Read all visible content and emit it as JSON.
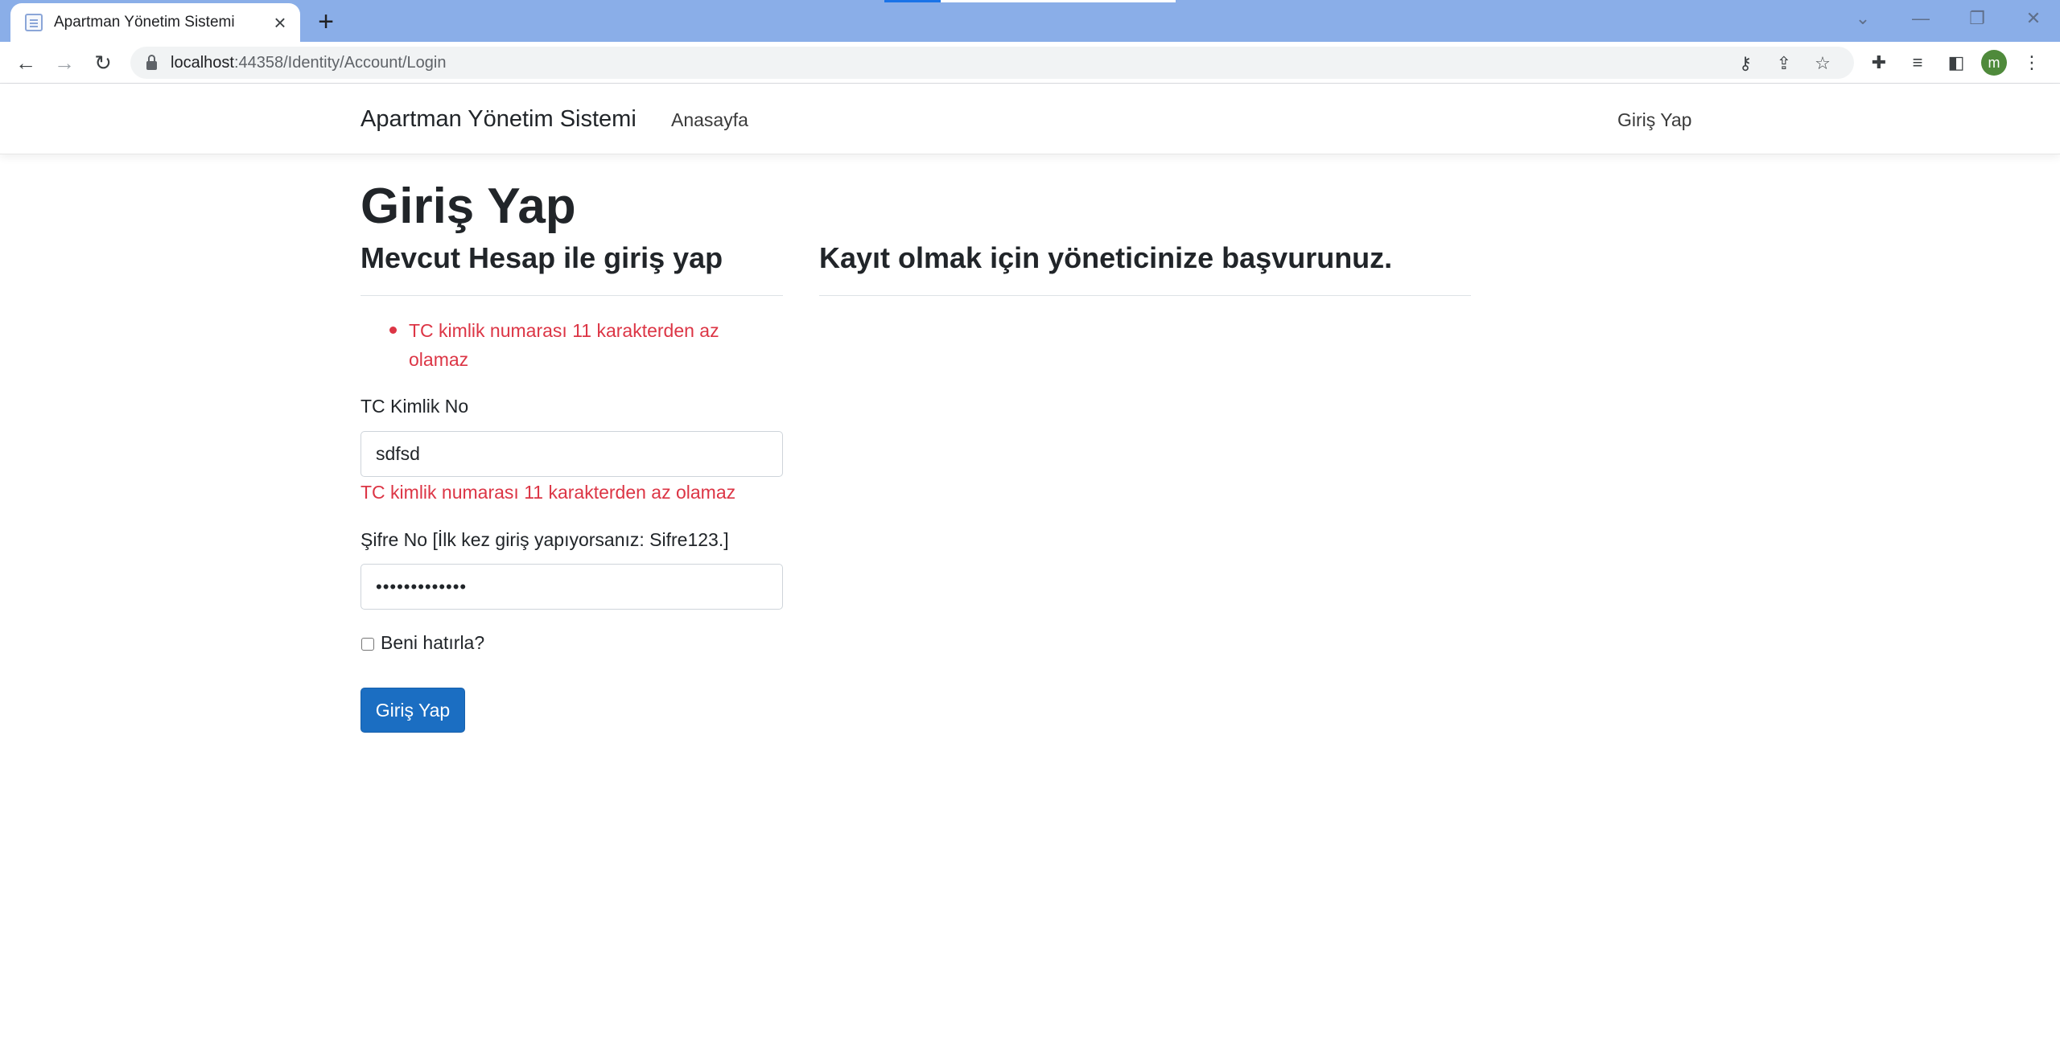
{
  "browser": {
    "tab_title": "Apartman Yönetim Sistemi",
    "url_host": "localhost",
    "url_rest": ":44358/Identity/Account/Login",
    "avatar_letter": "m"
  },
  "site": {
    "brand": "Apartman Yönetim Sistemi",
    "nav_home": "Anasayfa",
    "nav_login": "Giriş Yap"
  },
  "login": {
    "title": "Giriş Yap",
    "subtitle_left": "Mevcut Hesap ile giriş yap",
    "subtitle_right": "Kayıt olmak için yöneticinize başvurunuz.",
    "summary_errors": [
      "TC kimlik numarası 11 karakterden az",
      "olamaz"
    ],
    "tc_label": "TC Kimlik No",
    "tc_value": "sdfsd",
    "tc_error": "TC kimlik numarası 11 karakterden az olamaz",
    "password_label": "Şifre No [İlk kez giriş yapıyorsanız: Sifre123.]",
    "password_value": "•••••••••••••",
    "remember_label": "Beni hatırla?",
    "remember_checked": false,
    "submit_label": "Giriş Yap"
  },
  "colors": {
    "primary": "#1b6ec2",
    "danger": "#dc3545",
    "tabbar": "#8aaee8"
  }
}
